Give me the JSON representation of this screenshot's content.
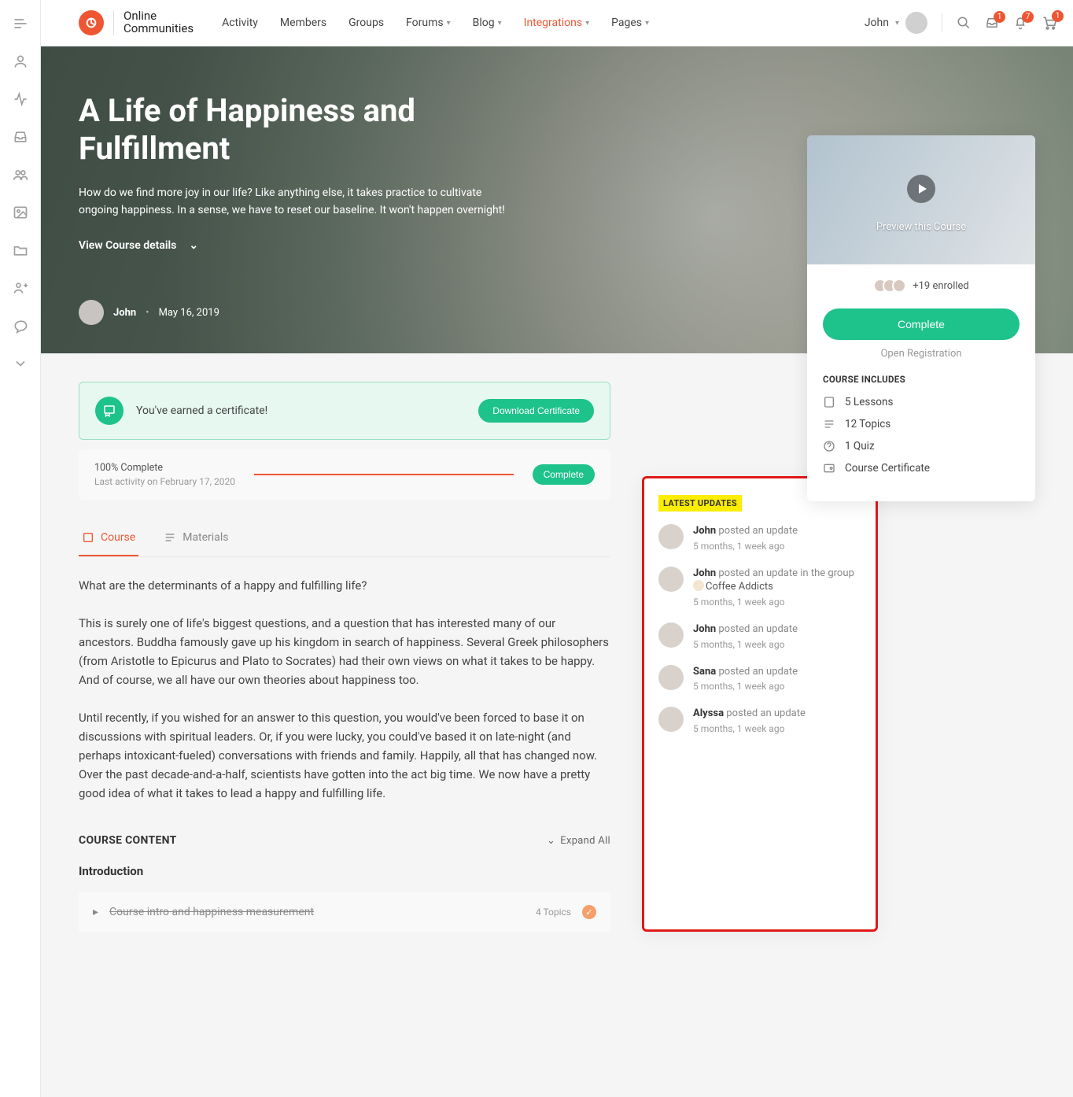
{
  "brand": {
    "name": "Online\nCommunities"
  },
  "nav": {
    "items": [
      {
        "label": "Activity",
        "dropdown": false
      },
      {
        "label": "Members",
        "dropdown": false
      },
      {
        "label": "Groups",
        "dropdown": false
      },
      {
        "label": "Forums",
        "dropdown": true
      },
      {
        "label": "Blog",
        "dropdown": true
      },
      {
        "label": "Integrations",
        "dropdown": true,
        "active": true
      },
      {
        "label": "Pages",
        "dropdown": true
      }
    ],
    "user_name": "John",
    "badges": {
      "mail": "1",
      "bell": "7",
      "cart": "1"
    }
  },
  "hero": {
    "title": "A Life of Happiness and Fulfillment",
    "subtitle": "How do we find more joy in our life? Like anything else, it takes practice to cultivate ongoing happiness. In a sense, we have to reset our baseline. It won't happen overnight!",
    "view_details": "View Course details",
    "author": "John",
    "date": "May 16, 2019"
  },
  "course_card": {
    "preview_label": "Preview this Course",
    "enrolled": "+19 enrolled",
    "complete_btn": "Complete",
    "open_reg": "Open Registration",
    "includes_title": "COURSE INCLUDES",
    "includes": [
      "5 Lessons",
      "12 Topics",
      "1 Quiz",
      "Course Certificate"
    ]
  },
  "cert": {
    "text": "You've earned a certificate!",
    "download": "Download Certificate"
  },
  "progress": {
    "label": "100% Complete",
    "sub": "Last activity on February 17, 2020",
    "btn": "Complete"
  },
  "tabs": {
    "course": "Course",
    "materials": "Materials"
  },
  "body": {
    "p1": "What are the determinants of a happy and fulfilling life?",
    "p2": "This is surely one of life's biggest questions, and a question that has interested many of our ancestors. Buddha famously gave up his kingdom in search of happiness. Several Greek philosophers (from Aristotle to Epicurus and Plato to Socrates) had their own views on what it takes to be happy. And of course, we all have our own theories about happiness too.",
    "p3": "Until recently, if you wished for an answer to this question, you would've been forced to base it on discussions with spiritual leaders. Or, if you were lucky, you could've based it on late-night (and perhaps intoxicant-fueled) conversations with friends and family. Happily, all that has changed now. Over the past decade-and-a-half, scientists have gotten into the act big time. We now have a pretty good idea of what it takes to lead a happy and fulfilling life."
  },
  "course_content": {
    "heading": "COURSE CONTENT",
    "expand": "Expand All",
    "section": "Introduction",
    "lesson": {
      "title": "Course intro and happiness measurement",
      "count": "4 Topics"
    }
  },
  "updates": {
    "title": "LATEST UPDATES",
    "items": [
      {
        "name": "John",
        "action": "posted an update",
        "group": "",
        "time": "5 months, 1 week ago"
      },
      {
        "name": "John",
        "action": "posted an update in the group",
        "group": "Coffee Addicts",
        "time": "5 months, 1 week ago"
      },
      {
        "name": "John",
        "action": "posted an update",
        "group": "",
        "time": "5 months, 1 week ago"
      },
      {
        "name": "Sana",
        "action": "posted an update",
        "group": "",
        "time": "5 months, 1 week ago"
      },
      {
        "name": "Alyssa",
        "action": "posted an update",
        "group": "",
        "time": "5 months, 1 week ago"
      }
    ]
  }
}
